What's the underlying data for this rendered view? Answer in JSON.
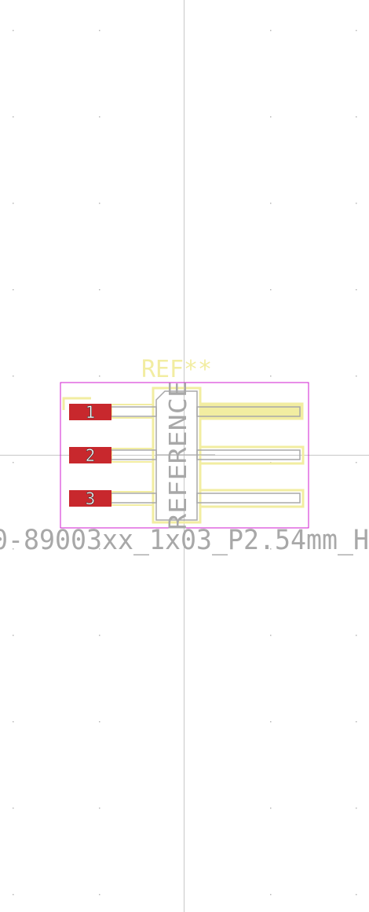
{
  "canvas": {
    "background_color": "#ffffff",
    "grid_dot_color": "#b8b8b8",
    "crosshair_color": "#c8c8c8"
  },
  "footprint": {
    "reference_designator": "REF**",
    "fab_reference_text": "REFERENCE",
    "value_text": "0-89003xx_1x03_P2.54mm_H",
    "colors": {
      "courtyard": "#d21ed2",
      "silkscreen": "#f2eda1",
      "fabrication": "#a8a8a8",
      "pad_fill": "#c8282d",
      "pad_number_text": "#ffffff"
    },
    "pads": [
      {
        "number": "1"
      },
      {
        "number": "2"
      },
      {
        "number": "3"
      }
    ]
  }
}
